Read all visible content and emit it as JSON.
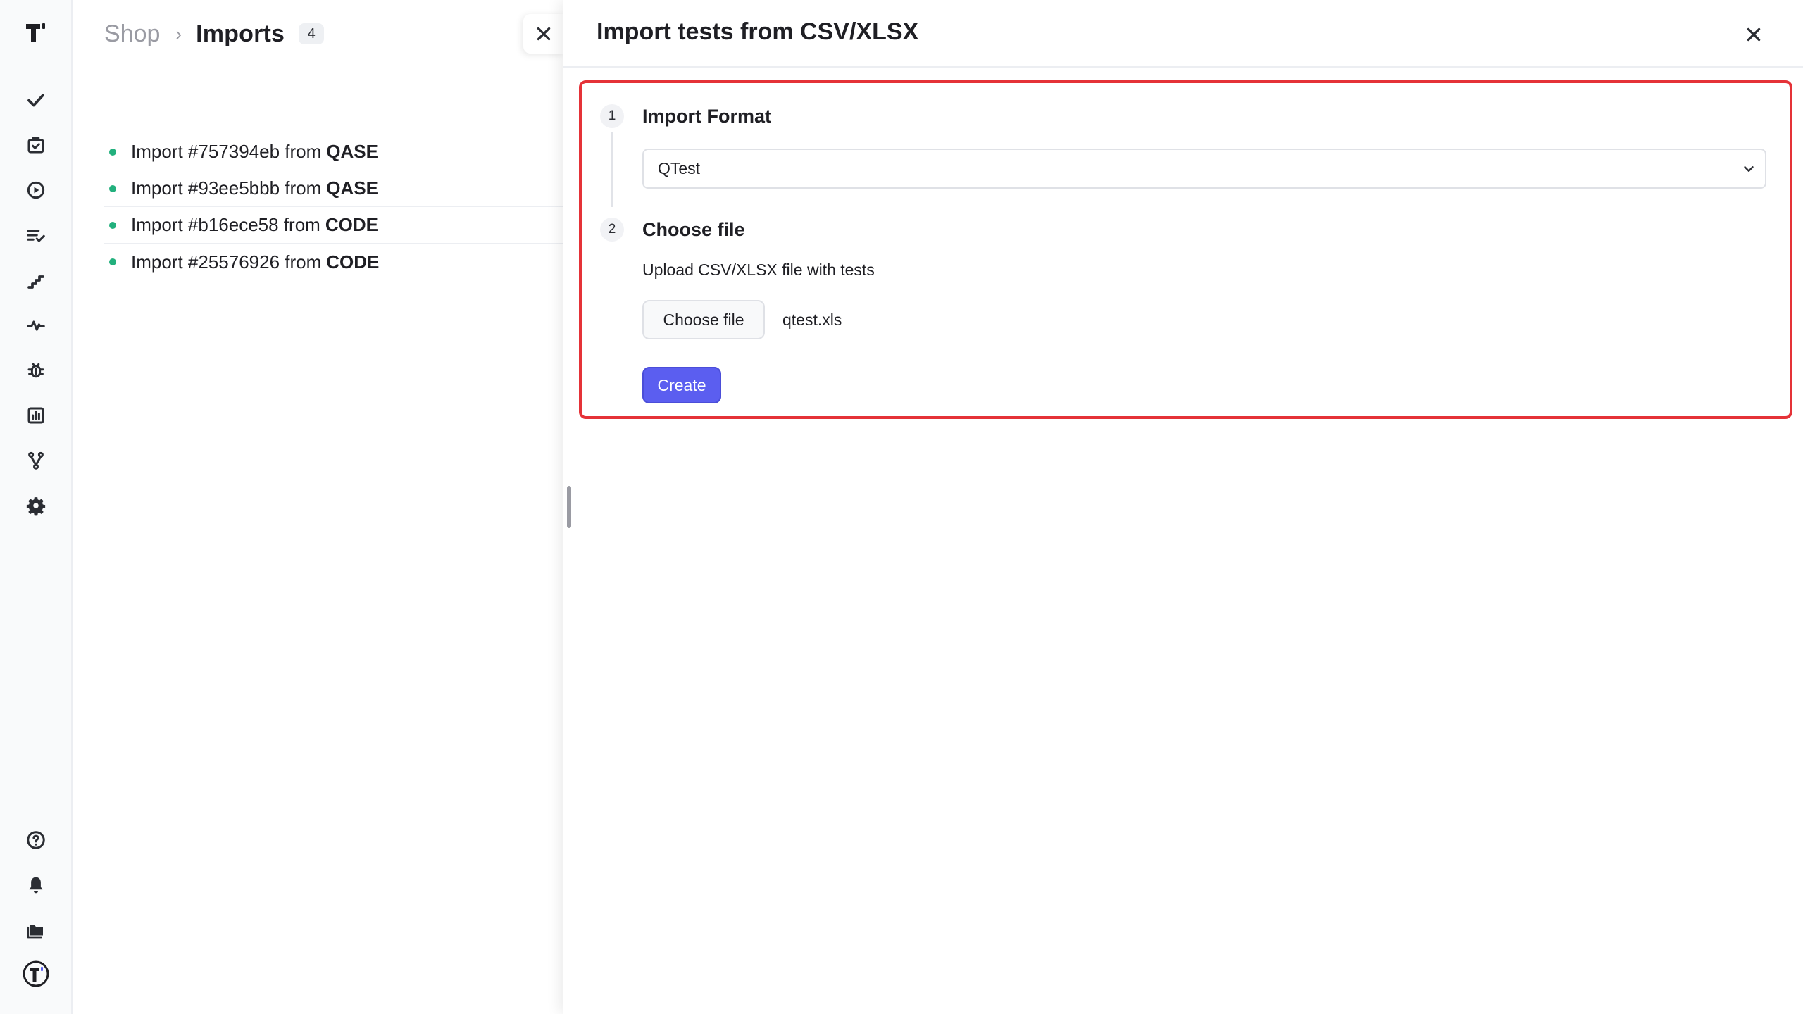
{
  "breadcrumb": {
    "project": "Shop",
    "separator": "›",
    "current": "Imports",
    "count": "4"
  },
  "imports": [
    {
      "label": "Import #757394eb from",
      "source": "QASE"
    },
    {
      "label": "Import #93ee5bbb from",
      "source": "QASE"
    },
    {
      "label": "Import #b16ece58 from",
      "source": "CODE"
    },
    {
      "label": "Import #25576926 from",
      "source": "CODE"
    }
  ],
  "panel": {
    "title": "Import tests from CSV/XLSX",
    "steps": [
      {
        "number": "1",
        "title": "Import Format"
      },
      {
        "number": "2",
        "title": "Choose file"
      }
    ],
    "format_value": "QTest",
    "upload_label": "Upload CSV/XLSX file with tests",
    "choose_file_label": "Choose file",
    "file_name": "qtest.xls",
    "create_label": "Create"
  },
  "colors": {
    "accent": "#5b5ef0",
    "status_dot": "#22b07d",
    "highlight_border": "#e53238"
  },
  "rail_icons": [
    "logo-icon",
    "check-icon",
    "clipboard-check-icon",
    "play-circle-icon",
    "list-check-icon",
    "steps-icon",
    "pulse-icon",
    "bug-icon",
    "bar-chart-icon",
    "branch-icon",
    "gear-icon",
    "help-icon",
    "bell-icon",
    "folder-icon",
    "profile-logo-icon"
  ]
}
